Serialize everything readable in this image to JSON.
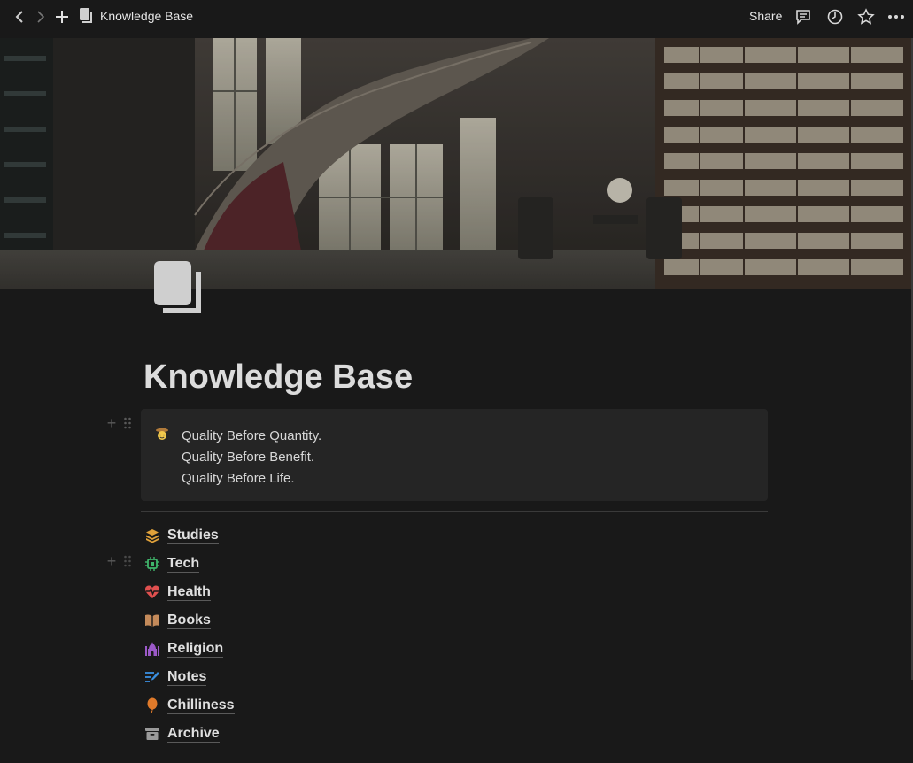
{
  "topbar": {
    "breadcrumb": "Knowledge Base",
    "share_label": "Share"
  },
  "page": {
    "title": "Knowledge Base",
    "callout": {
      "emoji": "cowboy-face-icon",
      "lines": [
        "Quality Before Quantity.",
        "Quality Before Benefit.",
        "Quality Before Life."
      ]
    },
    "links": [
      {
        "label": "Studies",
        "icon": "stack-icon",
        "color": "#e0a13a"
      },
      {
        "label": "Tech",
        "icon": "chip-icon",
        "color": "#3fb46a"
      },
      {
        "label": "Health",
        "icon": "heart-pulse-icon",
        "color": "#e0504f"
      },
      {
        "label": "Books",
        "icon": "open-book-icon",
        "color": "#c48a5a"
      },
      {
        "label": "Religion",
        "icon": "mosque-icon",
        "color": "#9b59c8"
      },
      {
        "label": "Notes",
        "icon": "notes-pen-icon",
        "color": "#3a8fe0"
      },
      {
        "label": "Chilliness",
        "icon": "balloon-icon",
        "color": "#e07a2a"
      },
      {
        "label": "Archive",
        "icon": "archive-box-icon",
        "color": "#9a9a9a"
      }
    ]
  },
  "colors": {
    "background": "#191919",
    "callout_bg": "#252525",
    "text": "#e0e0e0"
  }
}
